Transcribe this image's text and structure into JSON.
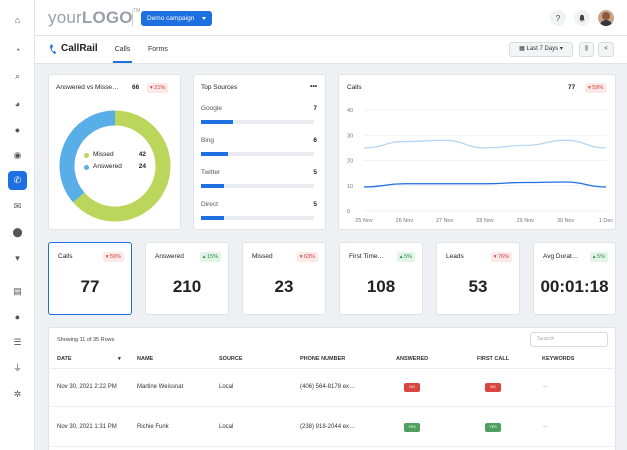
{
  "colors": {
    "accent": "#1e6fe0",
    "donut_missed": "#bcd65b",
    "donut_answered": "#5aaee8",
    "negative": "#d63b3b",
    "positive": "#2e8b46"
  },
  "sidebar": {
    "items": [
      {
        "icon": "home-icon"
      },
      {
        "icon": "dashboard-icon"
      },
      {
        "icon": "search-icon"
      },
      {
        "icon": "pie-chart-icon"
      },
      {
        "icon": "chat-icon"
      },
      {
        "icon": "message-icon"
      },
      {
        "icon": "phone-icon",
        "active": true
      },
      {
        "icon": "mail-icon"
      },
      {
        "icon": "location-icon"
      },
      {
        "icon": "cart-icon"
      },
      {
        "icon": "document-icon"
      },
      {
        "icon": "user-icon"
      },
      {
        "icon": "list-icon"
      },
      {
        "icon": "plug-icon"
      },
      {
        "icon": "gear-icon"
      }
    ]
  },
  "topbar": {
    "logo_prefix": "your",
    "logo_main": "LOGO",
    "logo_tm": "TM",
    "campaign_label": "Demo campaign",
    "help": "?"
  },
  "subbar": {
    "brand": "CallRail",
    "tabs": [
      "Calls",
      "Forms"
    ],
    "date_range": "Last 7 Days"
  },
  "answered_card": {
    "title": "Answered vs Misse…",
    "value": "66",
    "badge": "21%",
    "legend": [
      {
        "label": "Missed",
        "value": "42"
      },
      {
        "label": "Answered",
        "value": "24"
      }
    ]
  },
  "sources_card": {
    "title": "Top Sources",
    "menu": "•••",
    "items": [
      {
        "name": "Google",
        "value": "7"
      },
      {
        "name": "Bing",
        "value": "6"
      },
      {
        "name": "Twitter",
        "value": "5"
      },
      {
        "name": "Direct",
        "value": "5"
      }
    ]
  },
  "chart_data": {
    "type": "line",
    "title": "Calls",
    "value": "77",
    "badge": "59%",
    "x": [
      "25 Nov",
      "26 Nov",
      "27 Nov",
      "28 Nov",
      "29 Nov",
      "30 Nov",
      "1 Dec"
    ],
    "ylim": [
      0,
      40
    ],
    "yticks": [
      0,
      10,
      20,
      30,
      40
    ],
    "grid": true,
    "series": [
      {
        "values": [
          25,
          27.5,
          28,
          25,
          26,
          28,
          25
        ],
        "color": "#b9d6f5"
      },
      {
        "values": [
          9.5,
          10.8,
          10.8,
          10.8,
          11.3,
          11.5,
          9.5
        ],
        "color": "#1e6fe0"
      }
    ]
  },
  "kpis": [
    {
      "title": "Calls",
      "value": "77",
      "badge": "59%",
      "dir": "down"
    },
    {
      "title": "Answered",
      "value": "210",
      "badge": "15%",
      "dir": "up"
    },
    {
      "title": "Missed",
      "value": "23",
      "badge": "63%",
      "dir": "down"
    },
    {
      "title": "First Time…",
      "value": "108",
      "badge": "5%",
      "dir": "up"
    },
    {
      "title": "Leads",
      "value": "53",
      "badge": "76%",
      "dir": "down"
    },
    {
      "title": "Avg Durat…",
      "value": "00:01:18",
      "badge": "5%",
      "dir": "up"
    }
  ],
  "table": {
    "showing": "Showing 11 of 35 Rows",
    "search_placeholder": "Search",
    "headers": [
      "DATE",
      "NAME",
      "SOURCE",
      "PHONE NUMBER",
      "ANSWERED",
      "FIRST CALL",
      "KEYWORDS"
    ],
    "rows": [
      {
        "date": "Nov 30, 2021 2:22 PM",
        "name": "Martine Weissnat",
        "source": "Local",
        "phone": "(406) 564-8178 ex…",
        "answered": "NO",
        "first_call": "NO",
        "keywords": "--"
      },
      {
        "date": "Nov 30, 2021 1:31 PM",
        "name": "Richie Funk",
        "source": "Local",
        "phone": "(238) 918-2044 ex…",
        "answered": "YES",
        "first_call": "YES",
        "keywords": "--"
      }
    ]
  }
}
